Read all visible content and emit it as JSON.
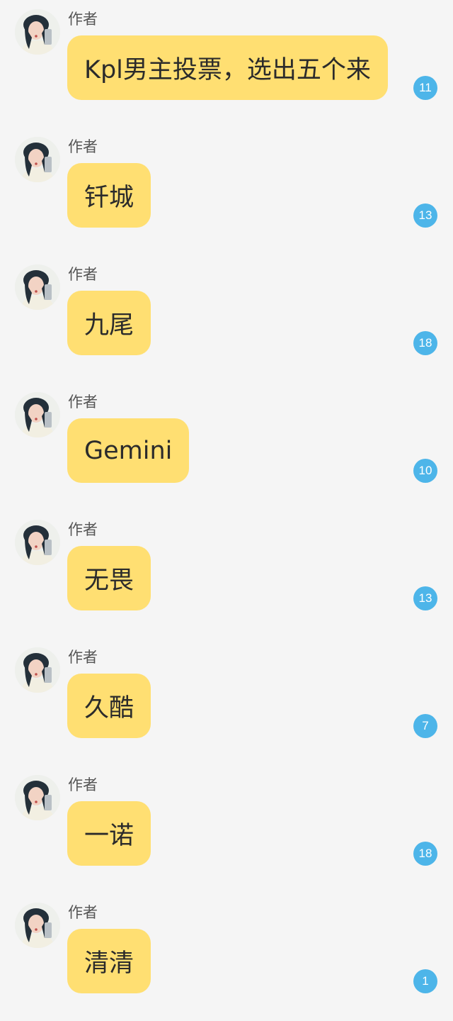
{
  "messages": [
    {
      "author": "作者",
      "text": "Kpl男主投票，选出五个来",
      "reply_count": "11"
    },
    {
      "author": "作者",
      "text": "钎城",
      "reply_count": "13"
    },
    {
      "author": "作者",
      "text": "九尾",
      "reply_count": "18"
    },
    {
      "author": "作者",
      "text": "Gemini",
      "reply_count": "10"
    },
    {
      "author": "作者",
      "text": "无畏",
      "reply_count": "13"
    },
    {
      "author": "作者",
      "text": "久酷",
      "reply_count": "7"
    },
    {
      "author": "作者",
      "text": "一诺",
      "reply_count": "18"
    },
    {
      "author": "作者",
      "text": "清清",
      "reply_count": "1"
    }
  ],
  "colors": {
    "background": "#f5f5f5",
    "bubble": "#ffdf72",
    "badge": "#4db5e9",
    "author_text": "#555555",
    "message_text": "#2b2b2b"
  }
}
